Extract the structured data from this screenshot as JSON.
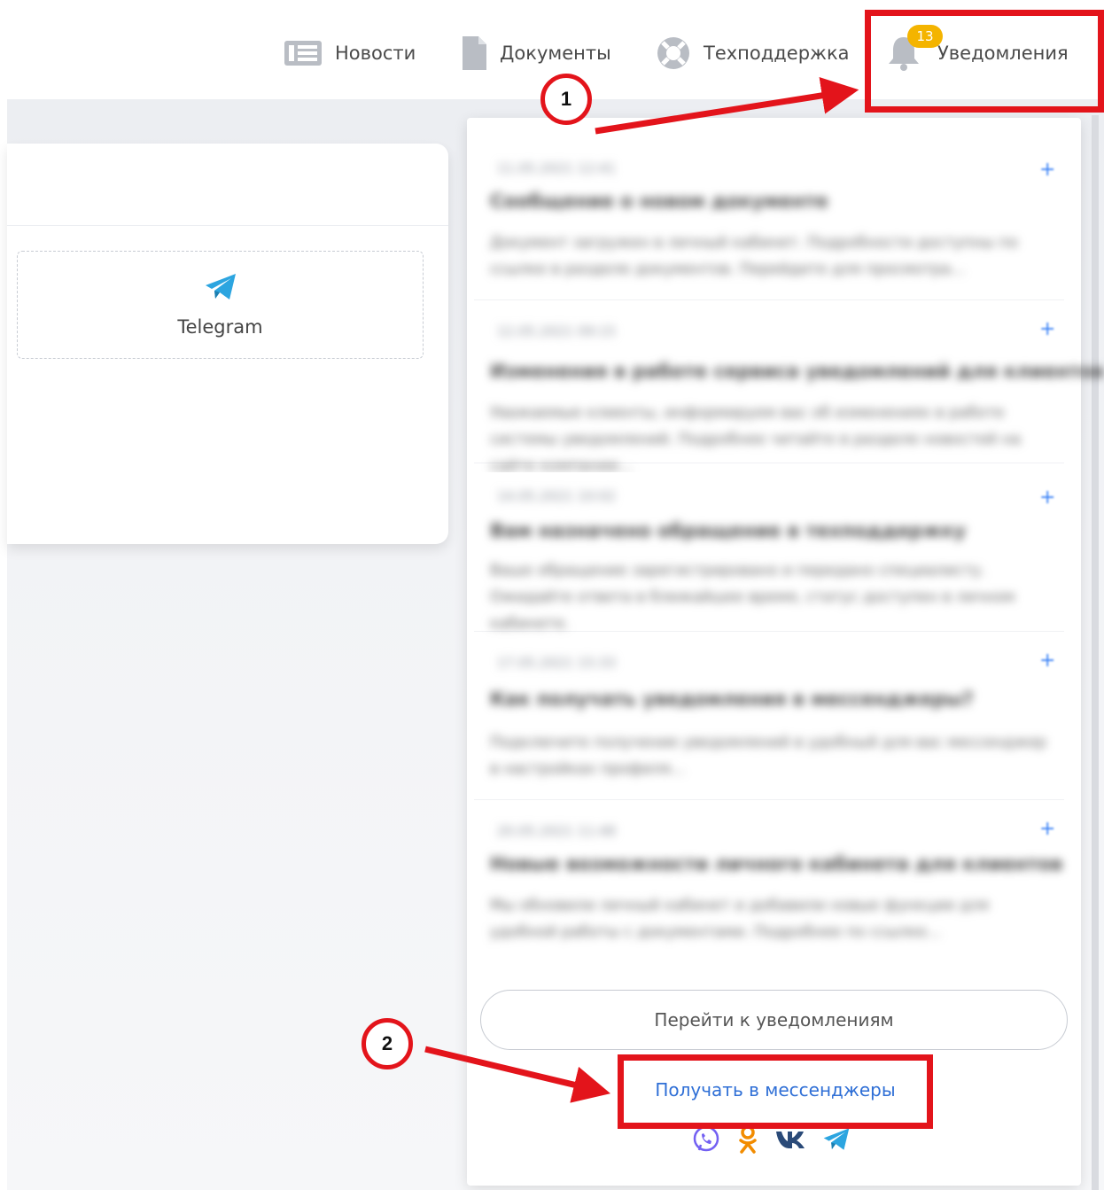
{
  "nav": {
    "news_label": "Новости",
    "documents_label": "Документы",
    "support_label": "Техподдержка",
    "notifications_label": "Уведомления",
    "notifications_count": "13"
  },
  "card": {
    "telegram_label": "Telegram"
  },
  "notifications_panel": {
    "items": [
      {
        "date": "11.05.2021 12:41",
        "title": "Сообщение о новом документе",
        "body": "Документ загружен в личный кабинет. Подробности доступны по ссылке в разделе документов. Перейдите для просмотра..."
      },
      {
        "date": "12.05.2021 09:15",
        "title": "Изменения в работе сервиса уведомлений для клиентов",
        "body": "Уважаемые клиенты, информируем вас об изменениях в работе системы уведомлений. Подробнее читайте в разделе новостей на сайте компании..."
      },
      {
        "date": "14.05.2021 10:02",
        "title": "Вам назначено обращение в техподдержку",
        "body": "Ваше обращение зарегистрировано и передано специалисту. Ожидайте ответа в ближайшее время, статус доступен в личном кабинете."
      },
      {
        "date": "17.05.2021 15:33",
        "title": "Как получать уведомления в мессенджеры?",
        "body": "Подключите получение уведомлений в удобный для вас мессенджер в настройках профиля..."
      },
      {
        "date": "20.05.2021 11:48",
        "title": "Новые возможности личного кабинета для клиентов",
        "body": "Мы обновили личный кабинет и добавили новые функции для удобной работы с документами. Подробнее по ссылке..."
      }
    ],
    "goto_button_label": "Перейти к уведомлениям",
    "messenger_link_label": "Получать в мессенджеры"
  },
  "annotations": {
    "step1_label": "1",
    "step2_label": "2"
  },
  "icons": {
    "news": "news-icon",
    "documents": "document-icon",
    "support": "lifebuoy-icon",
    "notifications": "bell-icon",
    "telegram": "telegram-icon",
    "socials": [
      "viber-icon",
      "odnoklassniki-icon",
      "vk-icon",
      "telegram-icon"
    ]
  },
  "colors": {
    "accent_link": "#2f6fd6",
    "badge": "#f4b400",
    "annotation_red": "#e3141b",
    "telegram_blue": "#2ca5e0",
    "ok_orange": "#f28c00",
    "vk_blue": "#4a76a8",
    "viber_purple": "#7360f2"
  }
}
